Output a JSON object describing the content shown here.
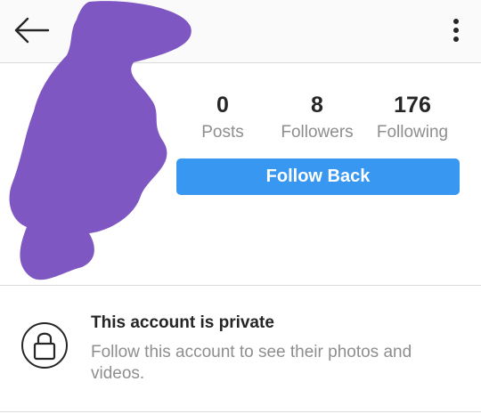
{
  "header": {
    "back_icon": "arrow-left-icon",
    "menu_icon": "more-vertical-icon"
  },
  "profile": {
    "stats": {
      "posts": {
        "count": "0",
        "label": "Posts"
      },
      "followers": {
        "count": "8",
        "label": "Followers"
      },
      "following": {
        "count": "176",
        "label": "Following"
      }
    },
    "follow_button_label": "Follow Back",
    "redaction_color": "#7e57c2"
  },
  "private_notice": {
    "icon": "lock-icon",
    "title": "This account is private",
    "description": "Follow this account to see their photos and videos."
  },
  "colors": {
    "accent": "#3897f0",
    "text_primary": "#262626",
    "text_secondary": "#8e8e8e"
  }
}
